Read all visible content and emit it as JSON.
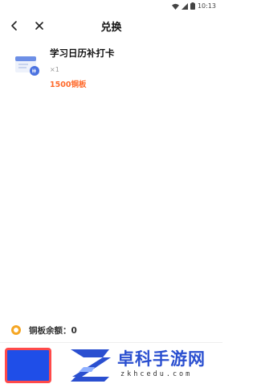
{
  "status_bar": {
    "time": "10:13"
  },
  "header": {
    "title": "兑换"
  },
  "item": {
    "name": "学习日历补打卡",
    "quantity": "×1",
    "price": "1500铜板"
  },
  "balance": {
    "label": "铜板余额：0"
  },
  "watermark": {
    "title": "卓科手游网",
    "url": "zkhcedu.com"
  },
  "colors": {
    "accent": "#1f4ee8",
    "price": "#ff6a2b",
    "coin": "#f5a623"
  }
}
